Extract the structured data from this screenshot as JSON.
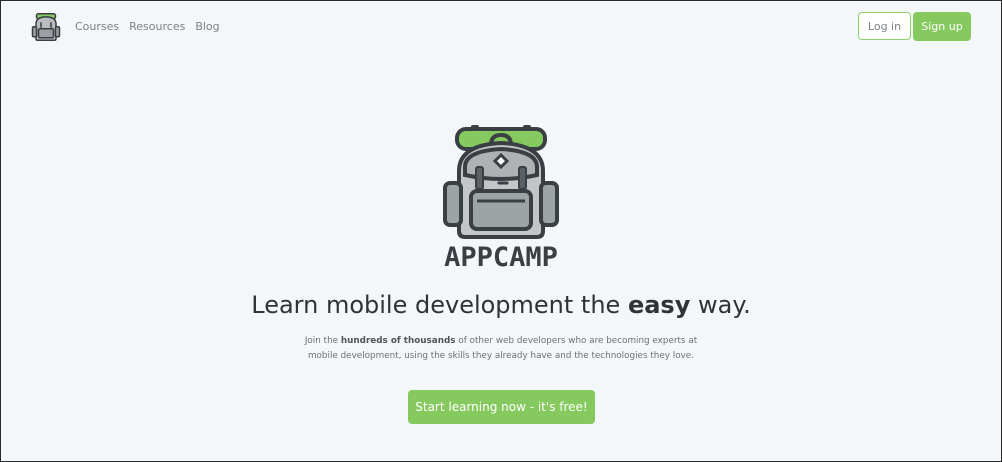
{
  "colors": {
    "accent_green": "#86c95f",
    "page_background": "#f4f7f9",
    "text_dark": "#2e3338",
    "text_muted": "#7c8286"
  },
  "header": {
    "logo_icon": "backpack-icon",
    "nav": [
      {
        "label": "Courses"
      },
      {
        "label": "Resources"
      },
      {
        "label": "Blog"
      }
    ],
    "login_label": "Log in",
    "signup_label": "Sign up"
  },
  "hero": {
    "logo_icon": "backpack-icon",
    "brand": "APPCAMP",
    "headline_prefix": "Learn mobile development the ",
    "headline_emphasis": "easy",
    "headline_suffix": " way.",
    "subtitle_prefix": "Join the ",
    "subtitle_emphasis": "hundreds of thousands",
    "subtitle_suffix": " of other web developers who are becoming experts at mobile development, using the skills they already have and the technologies they love.",
    "cta_label": "Start learning now - it's free!"
  }
}
